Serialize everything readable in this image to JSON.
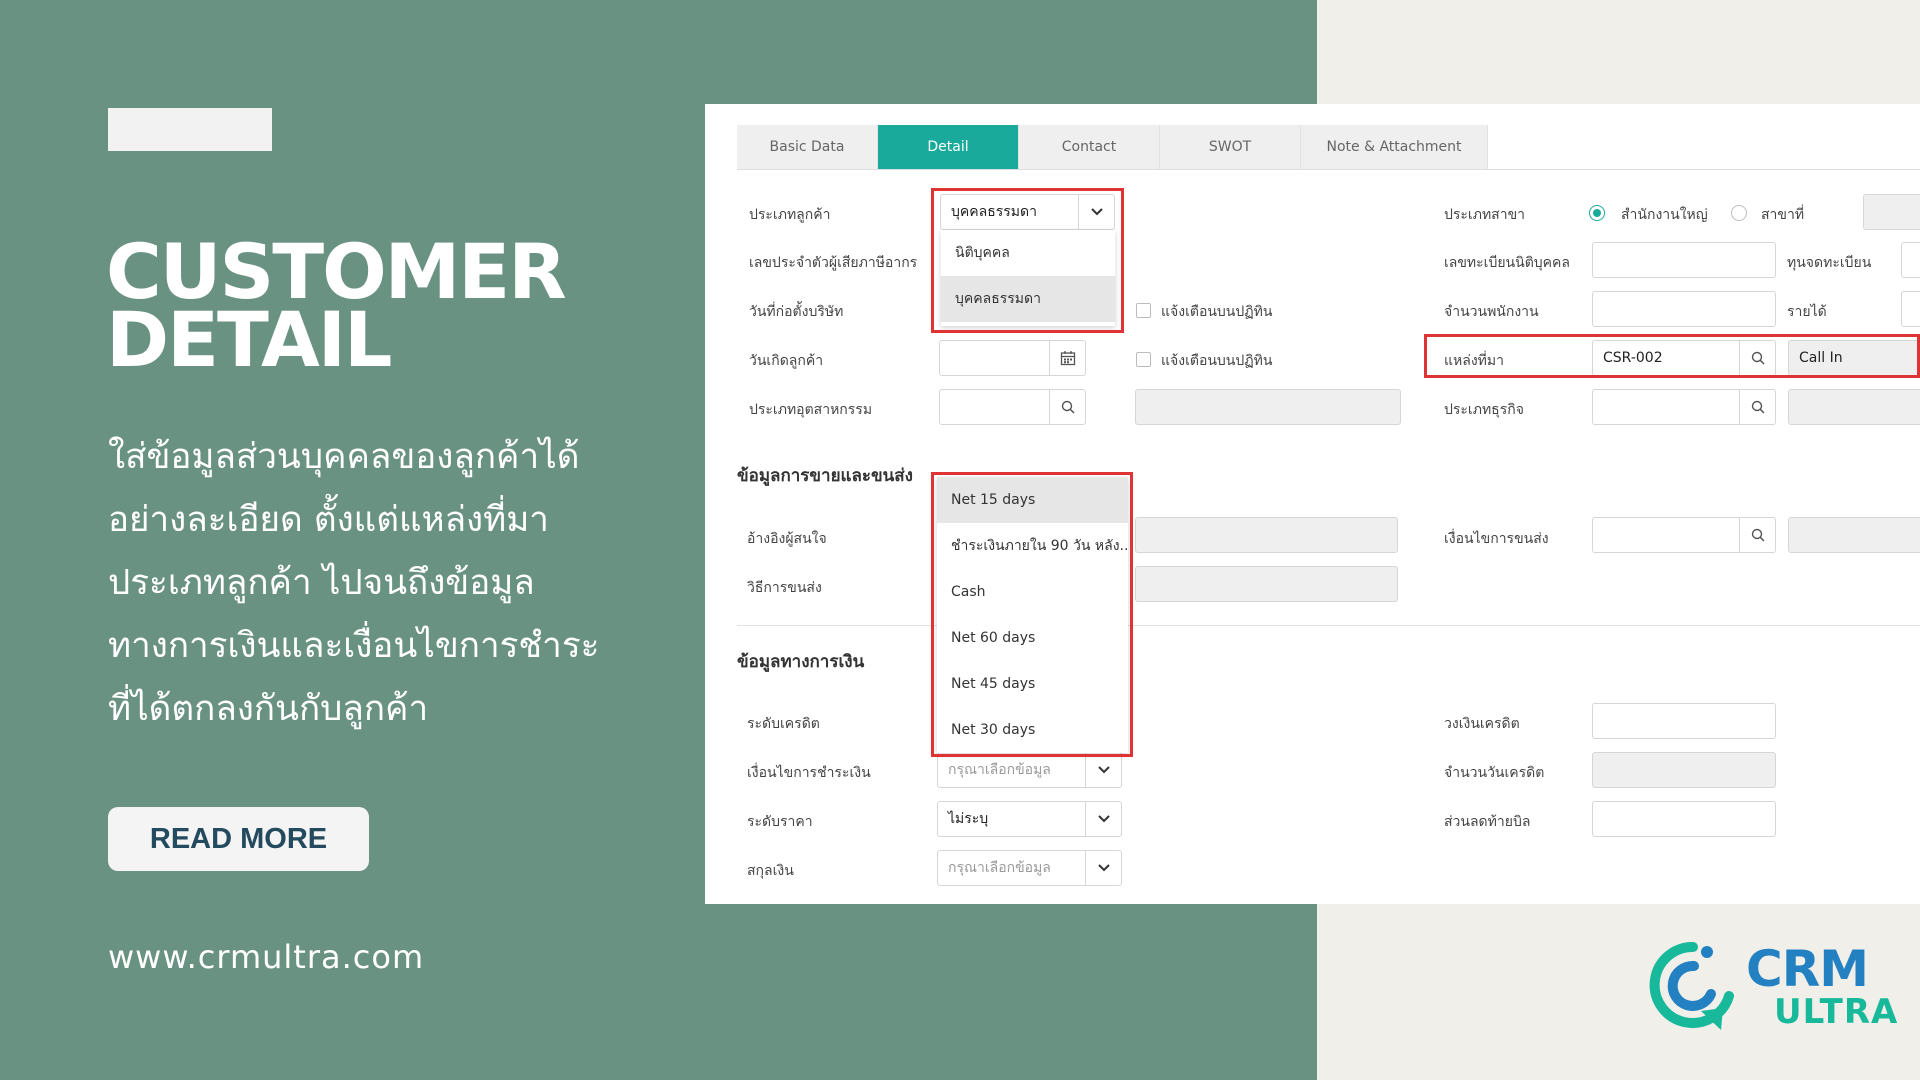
{
  "hero": {
    "headline_line1": "CUSTOMER",
    "headline_line2": "DETAIL",
    "desc_lines": [
      "ใส่ข้อมูลส่วนบุคคลของลูกค้าได้",
      "อย่างละเอียด ตั้งแต่แหล่งที่มา",
      "ประเภทลูกค้า ไปจนถึงข้อมูล",
      "ทางการเงินและเงื่อนไขการชำระ",
      "ที่ได้ตกลงกันกับลูกค้า"
    ],
    "read_more_label": "READ MORE",
    "website": "www.crmultra.com"
  },
  "logo": {
    "line1": "CRM",
    "line2": "ULTRA"
  },
  "tabs": [
    {
      "label": "Basic Data",
      "active": false
    },
    {
      "label": "Detail",
      "active": true
    },
    {
      "label": "Contact",
      "active": false
    },
    {
      "label": "SWOT",
      "active": false
    },
    {
      "label": "Note & Attachment",
      "active": false
    }
  ],
  "form": {
    "customer_type_label": "ประเภทลูกค้า",
    "customer_type_value": "บุคคลธรรมดา",
    "customer_type_options": [
      "นิติบุคคล",
      "บุคคลธรรมดา"
    ],
    "tax_id_label": "เลขประจำตัวผู้เสียภาษีอากร",
    "founded_label": "วันที่ก่อตั้งบริษัท",
    "notify_calendar_label": "แจ้งเตือนบนปฏิทิน",
    "birthday_label": "วันเกิดลูกค้า",
    "industry_label": "ประเภทอุตสาหกรรม",
    "branch_type_label": "ประเภทสาขา",
    "branch_head_office": "สำนักงานใหญ่",
    "branch_branch": "สาขาที่",
    "reg_number_label": "เลขทะเบียนนิติบุคคล",
    "reg_capital_label": "ทุนจดทะเบียน",
    "employees_label": "จำนวนพนักงาน",
    "revenue_label": "รายได้",
    "source_label": "แหล่งที่มา",
    "source_code": "CSR-002",
    "source_name": "Call In",
    "business_type_label": "ประเภทธุรกิจ"
  },
  "sales": {
    "section_title": "ข้อมูลการขายและขนส่ง",
    "lead_ref_label": "อ้างอิงผู้สนใจ",
    "shipping_method_label": "วิธีการขนส่ง",
    "shipping_terms_label": "เงื่อนไขการขนส่ง"
  },
  "finance": {
    "section_title": "ข้อมูลทางการเงิน",
    "credit_level_label": "ระดับเครดิต",
    "payment_terms_label": "เงื่อนไขการชำระเงิน",
    "payment_terms_placeholder": "กรุณาเลือกข้อมูล",
    "price_level_label": "ระดับราคา",
    "price_level_value": "ไม่ระบุ",
    "currency_label": "สกุลเงิน",
    "currency_placeholder": "กรุณาเลือกข้อมูล",
    "credit_limit_label": "วงเงินเครดิต",
    "credit_days_label": "จำนวนวันเครดิต",
    "bill_discount_label": "ส่วนลดท้ายบิล",
    "payment_options": [
      "Net 15 days",
      "ชำระเงินภายใน 90 วัน หลัง...",
      "Cash",
      "Net 60 days",
      "Net 45 days",
      "Net 30 days"
    ]
  },
  "colors": {
    "green_panel": "#6a9283",
    "accent": "#19aa9c",
    "highlight": "#e03336",
    "brand_blue": "#2381c2",
    "brand_green": "#17b99a"
  }
}
